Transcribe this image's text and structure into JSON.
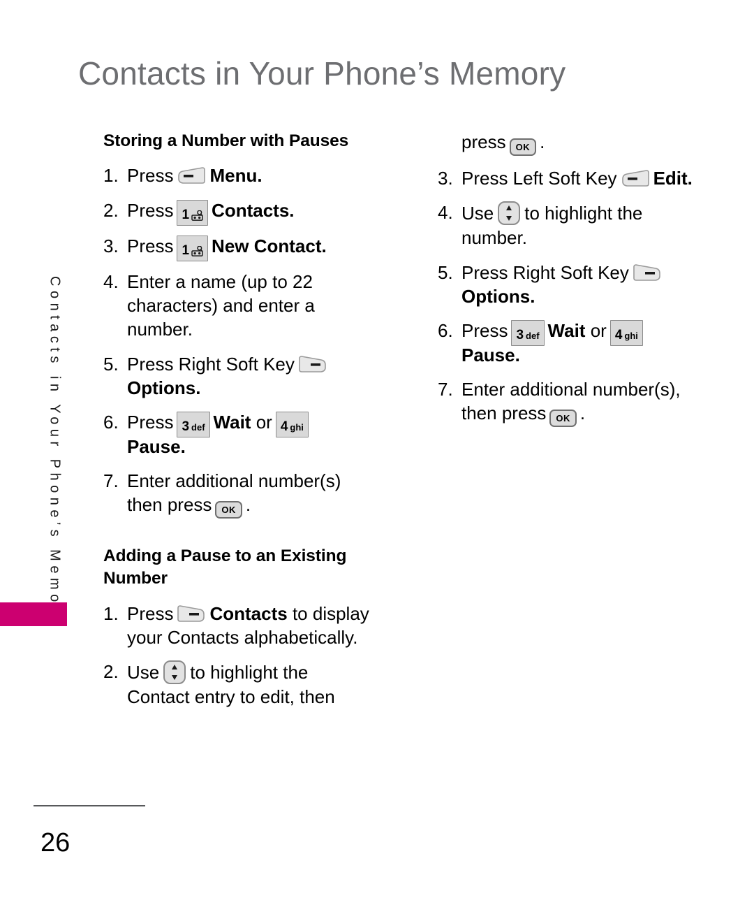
{
  "page_title": "Contacts in Your Phone’s Memory",
  "running_head": "Contacts in Your Phone’s Memory",
  "page_number": "26",
  "colors": {
    "tab_magenta": "#CC0070",
    "title_gray": "#6D6E71",
    "key_fill": "#D9D9D9",
    "key_border": "#8C8C8C"
  },
  "keys": {
    "left_soft": "left-soft-key",
    "right_soft": "right-soft-key",
    "ok": "OK",
    "nav": "navigation-up-down-key",
    "one_digit": "1",
    "one_letters": "voicemail-icon",
    "three_digit": "3",
    "three_letters": "def",
    "four_digit": "4",
    "four_letters": "ghi"
  },
  "left_column": {
    "heading": "Storing a Number with Pauses",
    "steps": [
      {
        "num": "1.",
        "pre": "Press",
        "key": "left-soft-key",
        "post": "Menu.",
        "post_bold": "Menu."
      },
      {
        "num": "2.",
        "pre": "Press",
        "key": "key-1",
        "post_bold": "Contacts."
      },
      {
        "num": "3.",
        "pre": "Press",
        "key": "key-1",
        "post_bold": "New Contact."
      },
      {
        "num": "4.",
        "text": "Enter a name (up to 22 characters) and enter a number.",
        "line1": "Enter a name (up to 22",
        "line2": "characters) and enter a",
        "line3": "number."
      },
      {
        "num": "5.",
        "pre": "Press Right Soft Key",
        "key": "right-soft-key",
        "post_bold": "Options."
      },
      {
        "num": "6.",
        "pre": "Press",
        "key_a": "key-3-def",
        "mid_bold": "Wait",
        "mid": "or",
        "key_b": "key-4-ghi",
        "post_bold": "Pause."
      },
      {
        "num": "7.",
        "line1": "Enter additional number(s)",
        "line2_pre": "then press",
        "key": "ok-key",
        "line2_post": "."
      }
    ],
    "heading2_line1": "Adding a Pause to an Existing",
    "heading2_line2": "Number",
    "steps2": [
      {
        "num": "1.",
        "pre": "Press",
        "key": "right-soft-key",
        "mid_bold": "Contacts",
        "post": "to display",
        "line2": "your Contacts alphabetically."
      },
      {
        "num": "2.",
        "pre": "Use",
        "key": "nav-key",
        "post": "to highlight the",
        "line2": "Contact entry to edit, then"
      }
    ]
  },
  "right_column": {
    "steps": [
      {
        "num": "",
        "pre": "press",
        "key": "ok-key",
        "post": "."
      },
      {
        "num": "3.",
        "pre": "Press Left Soft Key",
        "key": "left-soft-key",
        "post_bold": "Edit."
      },
      {
        "num": "4.",
        "pre": "Use",
        "key": "nav-key",
        "post": "to highlight the",
        "line2": "number."
      },
      {
        "num": "5.",
        "pre": "Press Right Soft Key",
        "key": "right-soft-key",
        "post_bold": "Options."
      },
      {
        "num": "6.",
        "pre": "Press",
        "key_a": "key-3-def",
        "mid_bold": "Wait",
        "mid": "or",
        "key_b": "key-4-ghi",
        "post_bold": "Pause."
      },
      {
        "num": "7.",
        "line1": "Enter additional number(s),",
        "line2_pre": "then press",
        "key": "ok-key",
        "line2_post": "."
      }
    ]
  }
}
